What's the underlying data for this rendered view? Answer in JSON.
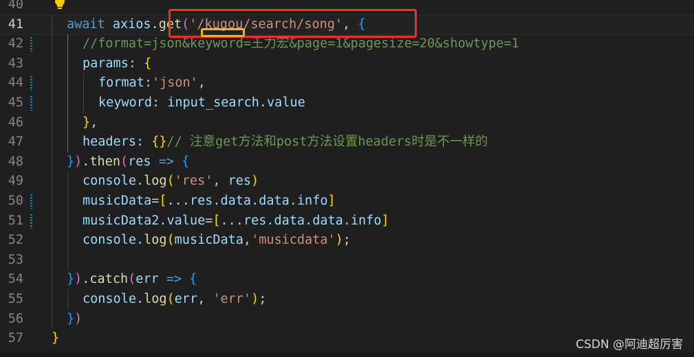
{
  "editor": {
    "lines": [
      {
        "num": "40",
        "indent": 0,
        "tokens": []
      },
      {
        "num": "41",
        "indent": 1,
        "current": true,
        "tokens": [
          {
            "t": "kw",
            "v": "await"
          },
          {
            "t": "pun",
            "v": " "
          },
          {
            "t": "var",
            "v": "axios"
          },
          {
            "t": "pun",
            "v": "."
          },
          {
            "t": "fn",
            "v": "get"
          },
          {
            "t": "b2",
            "v": "("
          },
          {
            "t": "str",
            "v": "'/kugou/search/song'"
          },
          {
            "t": "pun",
            "v": ", "
          },
          {
            "t": "b3",
            "v": "{"
          }
        ]
      },
      {
        "num": "42",
        "indent": 2,
        "git": true,
        "tokens": [
          {
            "t": "com",
            "v": "//format=json&keyword=王力宏&page=1&pagesize=20&showtype=1"
          }
        ]
      },
      {
        "num": "43",
        "indent": 2,
        "tokens": [
          {
            "t": "var",
            "v": "params"
          },
          {
            "t": "pun",
            "v": ": "
          },
          {
            "t": "b1",
            "v": "{"
          }
        ]
      },
      {
        "num": "44",
        "indent": 3,
        "git": true,
        "tokens": [
          {
            "t": "var",
            "v": "format"
          },
          {
            "t": "pun",
            "v": ":"
          },
          {
            "t": "str",
            "v": "'json'"
          },
          {
            "t": "pun",
            "v": ","
          }
        ]
      },
      {
        "num": "45",
        "indent": 3,
        "git": true,
        "tokens": [
          {
            "t": "var",
            "v": "keyword"
          },
          {
            "t": "pun",
            "v": ": "
          },
          {
            "t": "var",
            "v": "input_search"
          },
          {
            "t": "pun",
            "v": "."
          },
          {
            "t": "var",
            "v": "value"
          }
        ]
      },
      {
        "num": "46",
        "indent": 2,
        "tokens": [
          {
            "t": "b1",
            "v": "}"
          },
          {
            "t": "pun",
            "v": ","
          }
        ]
      },
      {
        "num": "47",
        "indent": 2,
        "tokens": [
          {
            "t": "var",
            "v": "headers"
          },
          {
            "t": "pun",
            "v": ": "
          },
          {
            "t": "b1",
            "v": "{}"
          },
          {
            "t": "com",
            "v": "// 注意get方法和post方法设置headers时是不一样的"
          }
        ]
      },
      {
        "num": "48",
        "indent": 1,
        "tokens": [
          {
            "t": "b3",
            "v": "}"
          },
          {
            "t": "b2",
            "v": ")"
          },
          {
            "t": "pun",
            "v": "."
          },
          {
            "t": "fn",
            "v": "then"
          },
          {
            "t": "b2",
            "v": "("
          },
          {
            "t": "var",
            "v": "res"
          },
          {
            "t": "pun",
            "v": " "
          },
          {
            "t": "kw",
            "v": "=>"
          },
          {
            "t": "pun",
            "v": " "
          },
          {
            "t": "b3",
            "v": "{"
          }
        ]
      },
      {
        "num": "49",
        "indent": 2,
        "tokens": [
          {
            "t": "var",
            "v": "console"
          },
          {
            "t": "pun",
            "v": "."
          },
          {
            "t": "fn",
            "v": "log"
          },
          {
            "t": "b1",
            "v": "("
          },
          {
            "t": "str",
            "v": "'res'"
          },
          {
            "t": "pun",
            "v": ", "
          },
          {
            "t": "var",
            "v": "res"
          },
          {
            "t": "b1",
            "v": ")"
          }
        ]
      },
      {
        "num": "50",
        "indent": 2,
        "git": true,
        "tokens": [
          {
            "t": "var",
            "v": "musicData"
          },
          {
            "t": "pun",
            "v": "="
          },
          {
            "t": "b1",
            "v": "["
          },
          {
            "t": "pun",
            "v": "..."
          },
          {
            "t": "var",
            "v": "res"
          },
          {
            "t": "pun",
            "v": "."
          },
          {
            "t": "var",
            "v": "data"
          },
          {
            "t": "pun",
            "v": "."
          },
          {
            "t": "var",
            "v": "data"
          },
          {
            "t": "pun",
            "v": "."
          },
          {
            "t": "var",
            "v": "info"
          },
          {
            "t": "b1",
            "v": "]"
          }
        ]
      },
      {
        "num": "51",
        "indent": 2,
        "git": true,
        "tokens": [
          {
            "t": "var",
            "v": "musicData2"
          },
          {
            "t": "pun",
            "v": "."
          },
          {
            "t": "var",
            "v": "value"
          },
          {
            "t": "pun",
            "v": "="
          },
          {
            "t": "b1",
            "v": "["
          },
          {
            "t": "pun",
            "v": "..."
          },
          {
            "t": "var",
            "v": "res"
          },
          {
            "t": "pun",
            "v": "."
          },
          {
            "t": "var",
            "v": "data"
          },
          {
            "t": "pun",
            "v": "."
          },
          {
            "t": "var",
            "v": "data"
          },
          {
            "t": "pun",
            "v": "."
          },
          {
            "t": "var",
            "v": "info"
          },
          {
            "t": "b1",
            "v": "]"
          }
        ]
      },
      {
        "num": "52",
        "indent": 2,
        "tokens": [
          {
            "t": "var",
            "v": "console"
          },
          {
            "t": "pun",
            "v": "."
          },
          {
            "t": "fn",
            "v": "log"
          },
          {
            "t": "b1",
            "v": "("
          },
          {
            "t": "var",
            "v": "musicData"
          },
          {
            "t": "pun",
            "v": ","
          },
          {
            "t": "str",
            "v": "'musicdata'"
          },
          {
            "t": "b1",
            "v": ")"
          },
          {
            "t": "pun",
            "v": ";"
          }
        ]
      },
      {
        "num": "53",
        "indent": 2,
        "tokens": []
      },
      {
        "num": "54",
        "indent": 1,
        "tokens": [
          {
            "t": "b3",
            "v": "}"
          },
          {
            "t": "b2",
            "v": ")"
          },
          {
            "t": "pun",
            "v": "."
          },
          {
            "t": "fn",
            "v": "catch"
          },
          {
            "t": "b2",
            "v": "("
          },
          {
            "t": "var",
            "v": "err"
          },
          {
            "t": "pun",
            "v": " "
          },
          {
            "t": "kw",
            "v": "=>"
          },
          {
            "t": "pun",
            "v": " "
          },
          {
            "t": "b3",
            "v": "{"
          }
        ]
      },
      {
        "num": "55",
        "indent": 2,
        "tokens": [
          {
            "t": "var",
            "v": "console"
          },
          {
            "t": "pun",
            "v": "."
          },
          {
            "t": "fn",
            "v": "log"
          },
          {
            "t": "b1",
            "v": "("
          },
          {
            "t": "var",
            "v": "err"
          },
          {
            "t": "pun",
            "v": ", "
          },
          {
            "t": "str",
            "v": "'err'"
          },
          {
            "t": "b1",
            "v": ")"
          },
          {
            "t": "pun",
            "v": ";"
          }
        ]
      },
      {
        "num": "56",
        "indent": 1,
        "tokens": [
          {
            "t": "b3",
            "v": "}"
          },
          {
            "t": "b2",
            "v": ")"
          }
        ]
      },
      {
        "num": "57",
        "indent": 0,
        "tokens": [
          {
            "t": "b1",
            "v": "}"
          }
        ]
      }
    ]
  },
  "watermark": "CSDN @阿迪超厉害"
}
